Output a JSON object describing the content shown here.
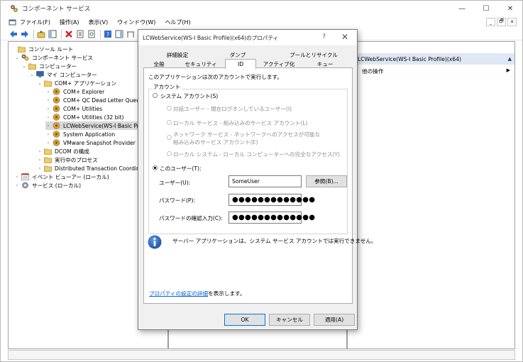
{
  "app": {
    "title": "コンポーネント サービス",
    "window_controls": {
      "minimize": "—",
      "maximize": "☐",
      "close": "✕"
    },
    "mdi_controls": {
      "minimize": "_",
      "restore": "🗗",
      "close": "✕"
    }
  },
  "menu": [
    {
      "label": "ファイル(F)"
    },
    {
      "label": "操作(A)"
    },
    {
      "label": "表示(V)"
    },
    {
      "label": "ウィンドウ(W)"
    },
    {
      "label": "ヘルプ(H)"
    }
  ],
  "tree": [
    {
      "label": "コンソール ルート",
      "level": 0,
      "expander": "",
      "icon": "folder-icon"
    },
    {
      "label": "コンポーネント サービス",
      "level": 1,
      "expander": "⌄",
      "icon": "component-services-icon"
    },
    {
      "label": "コンピューター",
      "level": 2,
      "expander": "⌄",
      "icon": "folder-icon"
    },
    {
      "label": "マイ コンピューター",
      "level": 3,
      "expander": "⌄",
      "icon": "computer-icon"
    },
    {
      "label": "COM+ アプリケーション",
      "level": 4,
      "expander": "⌄",
      "icon": "folder-icon"
    },
    {
      "label": "COM+ Explorer",
      "level": 5,
      "expander": "›",
      "icon": "com-app-icon"
    },
    {
      "label": "COM+ QC Dead Letter Queue",
      "level": 5,
      "expander": "›",
      "icon": "com-app-icon"
    },
    {
      "label": "COM+ Utilities",
      "level": 5,
      "expander": "›",
      "icon": "com-app-icon"
    },
    {
      "label": "COM+ Utilities (32 bit)",
      "level": 5,
      "expander": "›",
      "icon": "com-app-icon"
    },
    {
      "label": "LCWebService(WS-I Basic Prof",
      "level": 5,
      "expander": "›",
      "icon": "com-app-icon",
      "selected": true
    },
    {
      "label": "System Application",
      "level": 5,
      "expander": "›",
      "icon": "com-app-icon"
    },
    {
      "label": "VMware Snapshot Provider",
      "level": 5,
      "expander": "›",
      "icon": "com-app-icon"
    },
    {
      "label": "DCOM の構成",
      "level": 4,
      "expander": "›",
      "icon": "folder-icon"
    },
    {
      "label": "実行中のプロセス",
      "level": 4,
      "expander": "›",
      "icon": "folder-icon"
    },
    {
      "label": "Distributed Transaction Coordinat",
      "level": 4,
      "expander": "›",
      "icon": "folder-icon"
    },
    {
      "label": "イベント ビューアー (ローカル)",
      "level": 1,
      "expander": "›",
      "icon": "event-viewer-icon"
    },
    {
      "label": "サービス (ローカル)",
      "level": 1,
      "expander": "›",
      "icon": "services-icon"
    }
  ],
  "actions": {
    "header": "LCWebService(WS-I Basic Profile)(x64)",
    "header_arrow": "▲",
    "other_ops": "他の操作",
    "other_ops_arrow": "▶"
  },
  "dialog": {
    "title": "LCWebService(WS-I Basic Profile)(x64)のプロパティ",
    "help": "?",
    "close": "✕",
    "tabs_row1": [
      "詳細設定",
      "ダンプ",
      "プールとリサイクル"
    ],
    "tabs_row2": [
      "全般",
      "セキュリティ",
      "ID",
      "アクティブ化",
      "キュー"
    ],
    "active_tab": "ID",
    "intro": "このアプリケーションは次のアカウントで実行します。",
    "account_group": "アカウント",
    "system_account": "システム アカウント(S)",
    "sys_options": [
      "対話ユーザー - 現在ログオンしているユーザー(I)",
      "ローカル サービス - 組み込みのサービス アカウント(L)",
      "ネットワーク サービス - ネットワークへのアクセスが可能な",
      "組み込みのサービス アカウント(E)",
      "ローカル システム - ローカル コンピューターへの完全なアクセス(Y)"
    ],
    "this_user": "このユーザー(T):",
    "user_label": "ユーザー(U):",
    "user_value": "SomeUser",
    "browse": "参照(B)...",
    "password_label": "パスワード(P):",
    "password_value": "●●●●●●●●●●●●●",
    "confirm_label": "パスワードの確認入力(C):",
    "confirm_value": "●●●●●●●●●●●●●",
    "info_text": "サーバー アプリケーションは、システム サービス アカウントでは実行できません。",
    "link_text": "プロパティの設定の詳細",
    "link_suffix": "を表示します。",
    "ok": "OK",
    "cancel": "キャンセル",
    "apply": "適用(A)"
  }
}
